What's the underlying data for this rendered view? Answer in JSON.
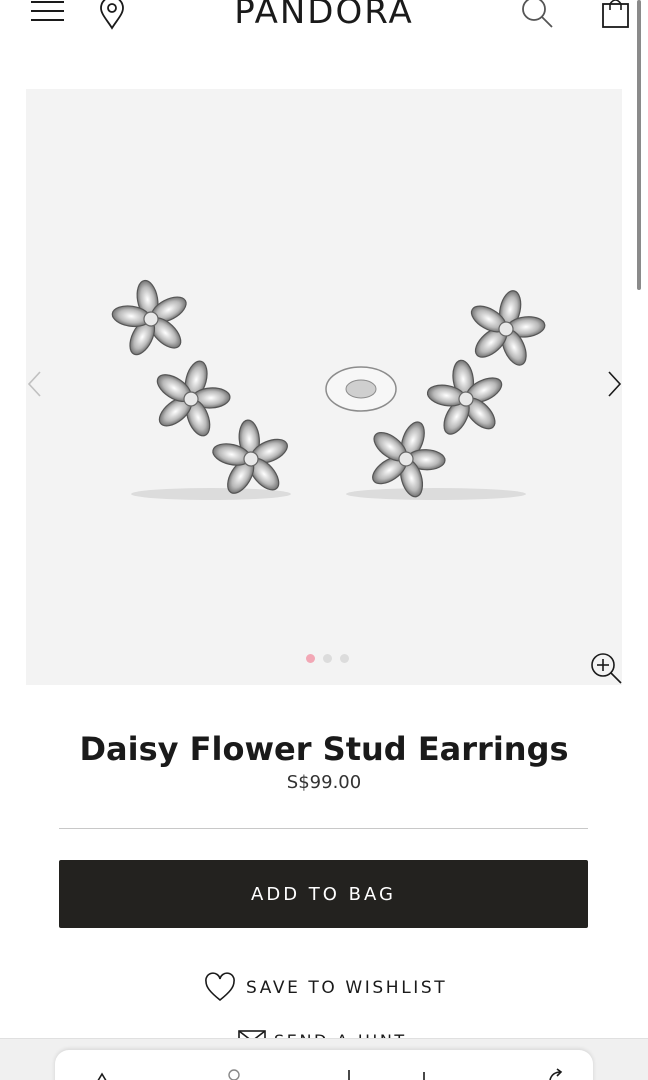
{
  "header": {
    "brand": "PANDORA",
    "icons": {
      "menu": "hamburger-menu-icon",
      "location": "map-pin-icon",
      "search": "magnifier-icon",
      "bag": "shopping-bag-icon"
    }
  },
  "gallery": {
    "image_alt": "Daisy Flower Stud Earrings",
    "slide_count": 3,
    "active_slide": 1,
    "colors": {
      "background": "#f3f3f3",
      "active_dot": "#f2a7b5",
      "inactive_dot": "#dcdcdc"
    }
  },
  "product": {
    "title": "Daisy Flower Stud Earrings",
    "price": "S$99.00"
  },
  "actions": {
    "add_to_bag": "ADD TO BAG",
    "wishlist": "SAVE TO WISHLIST",
    "send_hint": "SEND A HINT"
  },
  "colors": {
    "primary_button": "#23221f",
    "text": "#1a1a1a"
  }
}
